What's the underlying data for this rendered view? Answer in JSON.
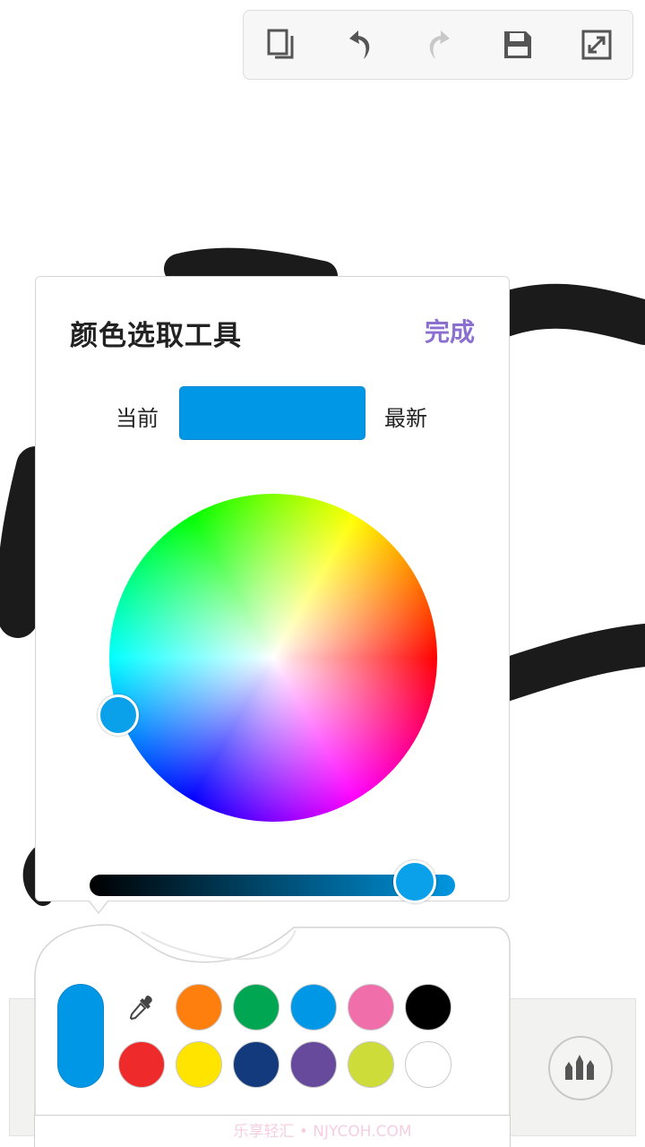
{
  "toolbar": {
    "icons": [
      "copy-icon",
      "undo-icon",
      "redo-icon",
      "save-icon",
      "fullscreen-icon"
    ],
    "icon_color": "#555555",
    "disabled_color": "#c8c8c8"
  },
  "color_picker": {
    "title": "颜色选取工具",
    "done_label": "完成",
    "current_label": "当前",
    "newest_label": "最新",
    "current_color": "#0098e6",
    "selected_color": "#0aa0ea",
    "brightness_level": 0.89,
    "accent_color": "#8a6fd1"
  },
  "palette": {
    "selected_color": "#0098e6",
    "swatches_row1": [
      "#ff7f0e",
      "#00a651",
      "#0098e6",
      "#f06ea9",
      "#000000"
    ],
    "swatches_row2": [
      "#ee2a2a",
      "#ffe400",
      "#133a7c",
      "#674a9c",
      "#cddc39",
      "#ffffff"
    ]
  },
  "watermark": "乐享轻汇 • NJYCOH.COM",
  "brush_button_icon": "brushes-icon"
}
